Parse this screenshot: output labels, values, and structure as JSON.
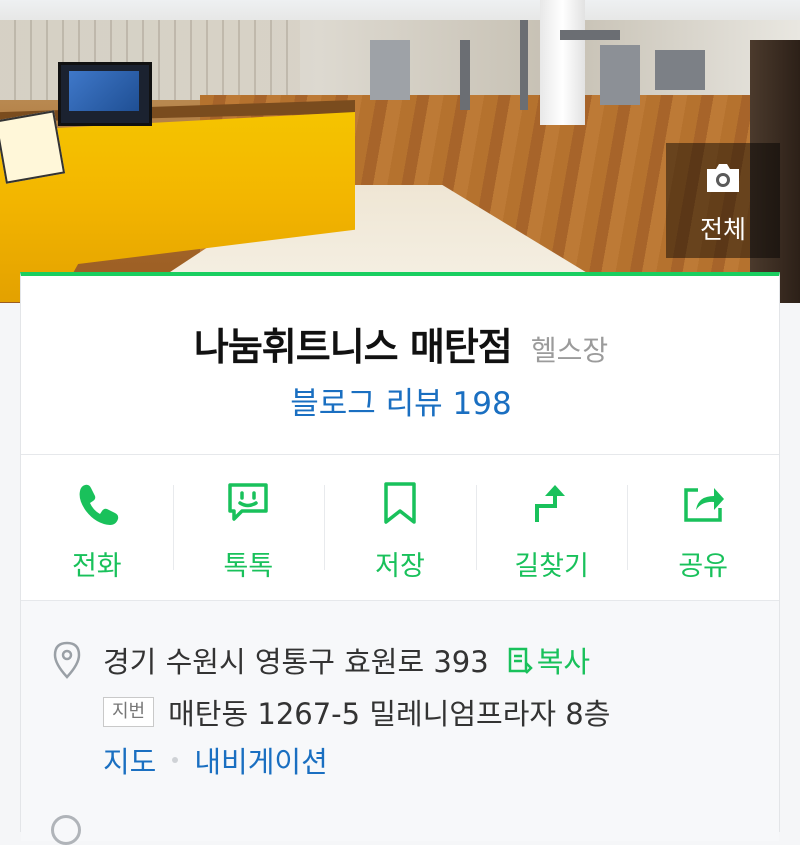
{
  "hero": {
    "photo_all_label": "전체",
    "icons": {
      "camera": "camera-icon"
    }
  },
  "place": {
    "name": "나눔휘트니스 매탄점",
    "category": "헬스장",
    "review_label": "블로그 리뷰 198"
  },
  "actions": [
    {
      "id": "call",
      "label": "전화",
      "icon": "phone-icon"
    },
    {
      "id": "talk",
      "label": "톡톡",
      "icon": "chat-icon"
    },
    {
      "id": "save",
      "label": "저장",
      "icon": "bookmark-icon"
    },
    {
      "id": "directions",
      "label": "길찾기",
      "icon": "directions-icon"
    },
    {
      "id": "share",
      "label": "공유",
      "icon": "share-icon"
    }
  ],
  "info": {
    "address": "경기 수원시 영통구 효원로 393",
    "copy_label": "복사",
    "jibun_badge": "지번",
    "jibun_address": "매탄동 1267-5 밀레니엄프라자 8층",
    "map_link": "지도",
    "navigation_link": "내비게이션"
  },
  "colors": {
    "accent_green": "#19ce60",
    "link_blue": "#1a6fc1"
  }
}
